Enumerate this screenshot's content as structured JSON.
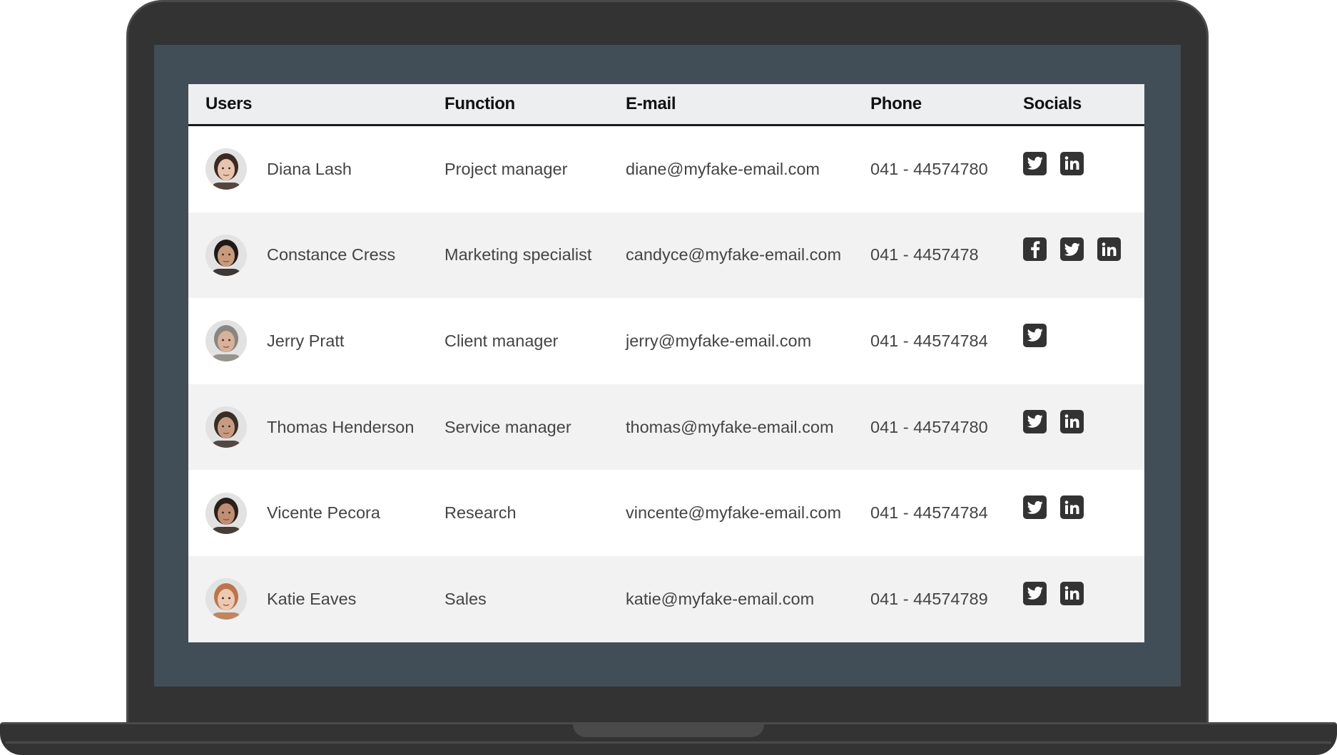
{
  "table": {
    "headers": {
      "users": "Users",
      "function": "Function",
      "email": "E-mail",
      "phone": "Phone",
      "socials": "Socials"
    },
    "rows": [
      {
        "name": "Diana Lash",
        "function": "Project manager",
        "email": "diane@myfake-email.com",
        "phone": "041 - 44574780",
        "socials": [
          "twitter",
          "linkedin"
        ],
        "avatar_hair": "#3b2a22",
        "avatar_skin": "#e8c4ae"
      },
      {
        "name": "Constance Cress",
        "function": "Marketing specialist",
        "email": "candyce@myfake-email.com",
        "phone": "041 - 4457478",
        "socials": [
          "facebook",
          "twitter",
          "linkedin"
        ],
        "avatar_hair": "#1f1a17",
        "avatar_skin": "#c99a7c"
      },
      {
        "name": "Jerry Pratt",
        "function": "Client manager",
        "email": "jerry@myfake-email.com",
        "phone": "041 - 44574784",
        "socials": [
          "twitter"
        ],
        "avatar_hair": "#8a8580",
        "avatar_skin": "#d7b19a"
      },
      {
        "name": "Thomas Henderson",
        "function": "Service manager",
        "email": "thomas@myfake-email.com",
        "phone": "041 - 44574780",
        "socials": [
          "twitter",
          "linkedin"
        ],
        "avatar_hair": "#3a2d26",
        "avatar_skin": "#c79b82"
      },
      {
        "name": "Vicente Pecora",
        "function": "Research",
        "email": "vincente@myfake-email.com",
        "phone": "041 - 44574784",
        "socials": [
          "twitter",
          "linkedin"
        ],
        "avatar_hair": "#2a201b",
        "avatar_skin": "#c08e74"
      },
      {
        "name": "Katie Eaves",
        "function": "Sales",
        "email": "katie@myfake-email.com",
        "phone": "041 - 44574789",
        "socials": [
          "twitter",
          "linkedin"
        ],
        "avatar_hair": "#b9764a",
        "avatar_skin": "#eec8b0"
      }
    ]
  },
  "colors": {
    "screen_bg": "#414e57",
    "laptop_body": "#333333",
    "header_bg": "#edeef0",
    "alt_row_bg": "#f2f2f2",
    "icon_bg": "#333333"
  },
  "icons": {
    "twitter": "twitter-icon",
    "linkedin": "linkedin-icon",
    "facebook": "facebook-icon"
  }
}
